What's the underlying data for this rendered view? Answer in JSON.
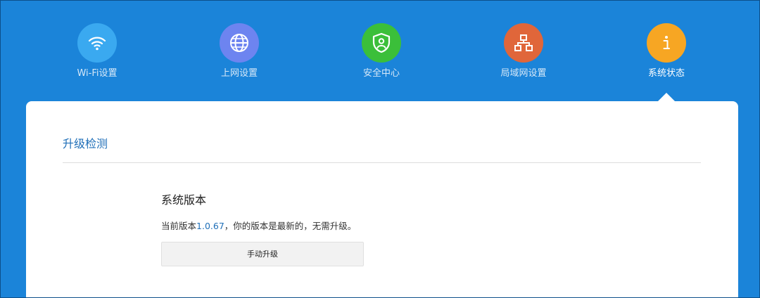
{
  "colors": {
    "header_bg": "#1b84d9",
    "accent_text": "#1f6fb8",
    "wifi": "#3aa9f0",
    "network": "#6d84f0",
    "security": "#3bbf3a",
    "lan": "#e0663a",
    "status": "#f7a623"
  },
  "nav": {
    "items": [
      {
        "label": "Wi-Fi设置",
        "icon": "wifi-icon"
      },
      {
        "label": "上网设置",
        "icon": "globe-icon"
      },
      {
        "label": "安全中心",
        "icon": "shield-user-icon"
      },
      {
        "label": "局域网设置",
        "icon": "network-topology-icon"
      },
      {
        "label": "系统状态",
        "icon": "info-icon",
        "active": true
      }
    ]
  },
  "main": {
    "section_title": "升级检测",
    "system_version": {
      "title": "系统版本",
      "prefix": "当前版本",
      "version": "1.0.67",
      "suffix": "，你的版本是最新的，无需升级。",
      "button_label": "手动升级"
    }
  }
}
